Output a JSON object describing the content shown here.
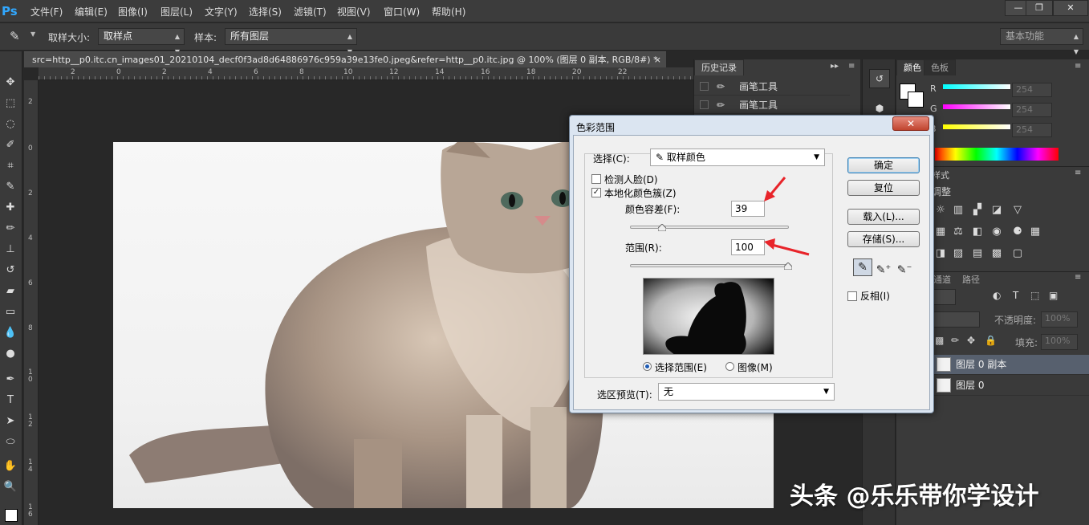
{
  "app": {
    "logo": "Ps",
    "menu": [
      "文件(F)",
      "编辑(E)",
      "图像(I)",
      "图层(L)",
      "文字(Y)",
      "选择(S)",
      "滤镜(T)",
      "视图(V)",
      "窗口(W)",
      "帮助(H)"
    ],
    "window_buttons": [
      "—",
      "❐",
      "✕"
    ]
  },
  "options_bar": {
    "tool_icon": "eyedropper-icon",
    "sample_size_label": "取样大小:",
    "sample_size_value": "取样点",
    "sample_label": "样本:",
    "sample_value": "所有图层",
    "workspace": "基本功能"
  },
  "document": {
    "tab_title": "src=http__p0.itc.cn_images01_20210104_decf0f3ad8d64886976c959a39e13fe0.jpeg&refer=http__p0.itc.jpg @ 100% (图层 0 副本, RGB/8#) *",
    "tab_close": "×"
  },
  "rulers": {
    "top": [
      "2",
      "0",
      "2",
      "4",
      "6",
      "8",
      "10",
      "12",
      "14",
      "16",
      "18",
      "20",
      "22"
    ],
    "left": [
      "2",
      "0",
      "2",
      "4",
      "6",
      "8",
      "1\n0",
      "1\n2",
      "1\n4",
      "1\n6"
    ]
  },
  "history_panel": {
    "tab": "历史记录",
    "rows": [
      "画笔工具",
      "画笔工具"
    ]
  },
  "color_panel": {
    "tabs": [
      "颜色",
      "色板"
    ],
    "channels": [
      {
        "name": "R",
        "value": "254",
        "color": "#00ffff"
      },
      {
        "name": "G",
        "value": "254",
        "color": "#ff00ff"
      },
      {
        "name": "B",
        "value": "254",
        "color": "#ffff00"
      }
    ]
  },
  "adjust_panel": {
    "tab": "样式",
    "header": "调整"
  },
  "layers_panel": {
    "tabs": [
      "通道",
      "路径"
    ],
    "opacity_label": "不透明度:",
    "opacity_value": "100%",
    "fill_label": "填充:",
    "fill_value": "100%",
    "layers": [
      {
        "name": "图层 0 副本",
        "selected": true
      },
      {
        "name": "图层 0",
        "selected": false
      }
    ]
  },
  "dialog": {
    "title": "色彩范围",
    "close": "✕",
    "select_label": "选择(C):",
    "select_value": "取样颜色",
    "detect_faces": "检测人脸(D)",
    "detect_faces_checked": false,
    "localized": "本地化颜色簇(Z)",
    "localized_checked": true,
    "fuzziness_label": "颜色容差(F):",
    "fuzziness_value": "39",
    "fuzziness_fraction": 0.2,
    "range_label": "范围(R):",
    "range_value": "100",
    "range_fraction": 1.0,
    "radio_selection": "选择范围(E)",
    "radio_image": "图像(M)",
    "preview_label": "选区预览(T):",
    "preview_value": "无",
    "buttons": {
      "ok": "确定",
      "reset": "复位",
      "load": "载入(L)...",
      "save": "存储(S)..."
    },
    "invert": "反相(I)",
    "invert_checked": false
  },
  "watermark": "头条 @乐乐带你学设计"
}
